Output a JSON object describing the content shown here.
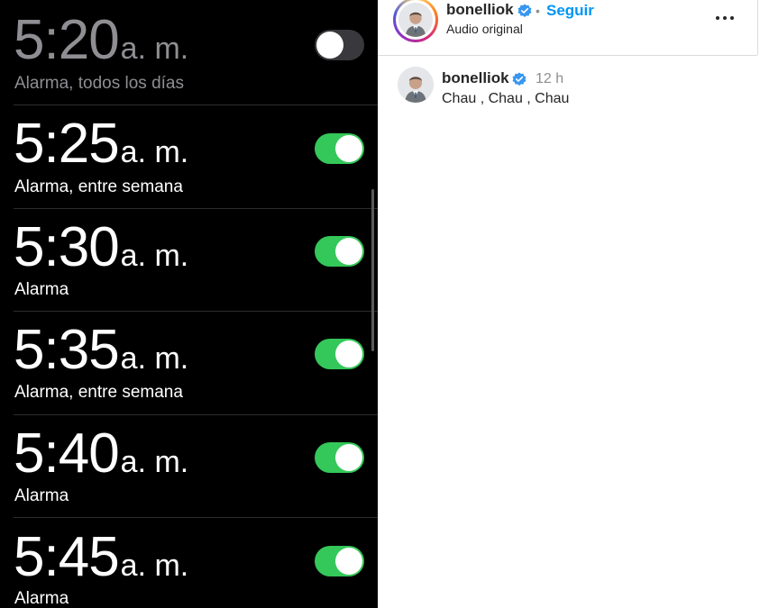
{
  "alarms": [
    {
      "time": "5:20",
      "ampm": "a. m.",
      "label": "Alarma, todos los días",
      "enabled": false
    },
    {
      "time": "5:25",
      "ampm": "a. m.",
      "label": "Alarma, entre semana",
      "enabled": true
    },
    {
      "time": "5:30",
      "ampm": "a. m.",
      "label": "Alarma",
      "enabled": true
    },
    {
      "time": "5:35",
      "ampm": "a. m.",
      "label": "Alarma, entre semana",
      "enabled": true
    },
    {
      "time": "5:40",
      "ampm": "a. m.",
      "label": "Alarma",
      "enabled": true
    },
    {
      "time": "5:45",
      "ampm": "a. m.",
      "label": "Alarma",
      "enabled": true
    }
  ],
  "post": {
    "username": "bonelliok",
    "separator": "•",
    "follow_label": "Seguir",
    "audio_label": "Audio original",
    "more_icon": "more-horizontal-icon",
    "verified_icon": "verified-badge-icon"
  },
  "comment": {
    "username": "bonelliok",
    "timestamp": "12 h",
    "text": "Chau , Chau , Chau"
  },
  "colors": {
    "toggle_on": "#34c759",
    "toggle_off": "#39393d",
    "follow_blue": "#0095f6",
    "verified_blue": "#3897f0"
  }
}
